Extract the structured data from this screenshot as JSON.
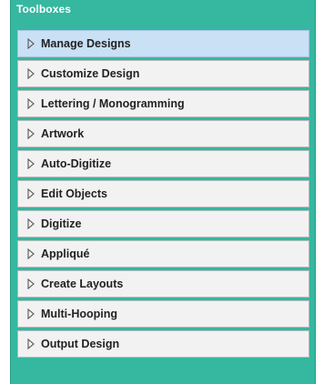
{
  "panel": {
    "title": "Toolboxes",
    "colors": {
      "header": "#36b7a0",
      "item_bg": "#f2f2f2",
      "selected_bg": "#c9e0f5"
    },
    "items": [
      {
        "label": "Manage Designs",
        "selected": true
      },
      {
        "label": "Customize Design",
        "selected": false
      },
      {
        "label": "Lettering / Monogramming",
        "selected": false
      },
      {
        "label": "Artwork",
        "selected": false
      },
      {
        "label": "Auto-Digitize",
        "selected": false
      },
      {
        "label": "Edit Objects",
        "selected": false
      },
      {
        "label": "Digitize",
        "selected": false
      },
      {
        "label": "Appliqué",
        "selected": false
      },
      {
        "label": "Create Layouts",
        "selected": false
      },
      {
        "label": "Multi-Hooping",
        "selected": false
      },
      {
        "label": "Output Design",
        "selected": false
      }
    ]
  }
}
